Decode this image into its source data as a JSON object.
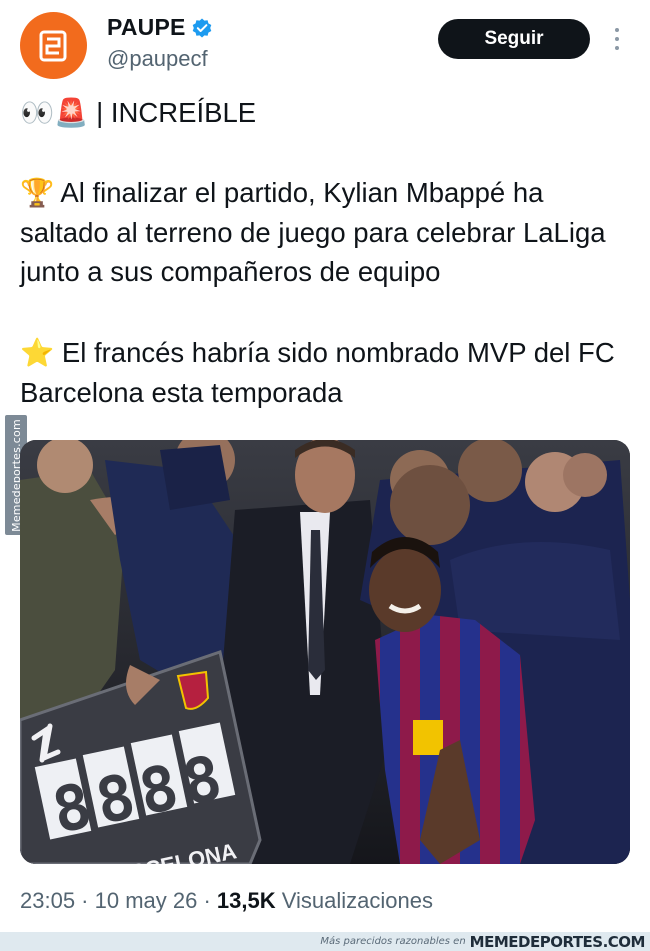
{
  "author": {
    "display_name": "PAUPE",
    "handle": "@paupecf",
    "avatar_icon": "paupe-logo-icon",
    "verified_icon": "verified-badge-icon",
    "avatar_color": "#f26b1d",
    "verified_color": "#1d9bf0"
  },
  "follow_button": {
    "label": "Seguir"
  },
  "more_icon": "more-options-icon",
  "tweet": {
    "line1_emoji": "👀🚨",
    "line1_text": " | INCREÍBLE",
    "para2_emoji": "🏆",
    "para2_text": " Al finalizar el partido, Kylian Mbappé ha saltado al terreno de juego para celebrar LaLiga junto a sus compañeros de equipo",
    "para3_emoji": "⭐",
    "para3_text": " El francés habría sido nombrado MVP del FC Barcelona esta temporada"
  },
  "photo": {
    "board_digits": "8888",
    "board_text": "ARCELONA"
  },
  "meta": {
    "time": "23:05",
    "sep1": " · ",
    "date": "10 may 26",
    "sep2": " · ",
    "views_count": "13,5K",
    "views_label": " Visualizaciones"
  },
  "watermark": {
    "side_text": "Memedeportes.com",
    "footer_tagline": "Más parecidos razonables en",
    "footer_brand": "MEMEDEPORTES.COM"
  }
}
